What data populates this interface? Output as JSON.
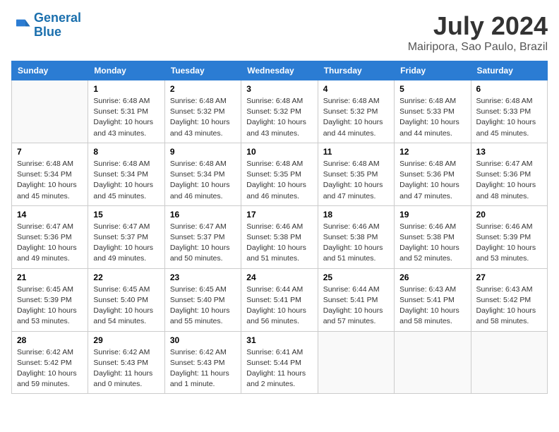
{
  "header": {
    "logo_line1": "General",
    "logo_line2": "Blue",
    "title": "July 2024",
    "subtitle": "Mairipora, Sao Paulo, Brazil"
  },
  "calendar": {
    "days_of_week": [
      "Sunday",
      "Monday",
      "Tuesday",
      "Wednesday",
      "Thursday",
      "Friday",
      "Saturday"
    ],
    "weeks": [
      [
        {
          "day": "",
          "info": ""
        },
        {
          "day": "1",
          "info": "Sunrise: 6:48 AM\nSunset: 5:31 PM\nDaylight: 10 hours\nand 43 minutes."
        },
        {
          "day": "2",
          "info": "Sunrise: 6:48 AM\nSunset: 5:32 PM\nDaylight: 10 hours\nand 43 minutes."
        },
        {
          "day": "3",
          "info": "Sunrise: 6:48 AM\nSunset: 5:32 PM\nDaylight: 10 hours\nand 43 minutes."
        },
        {
          "day": "4",
          "info": "Sunrise: 6:48 AM\nSunset: 5:32 PM\nDaylight: 10 hours\nand 44 minutes."
        },
        {
          "day": "5",
          "info": "Sunrise: 6:48 AM\nSunset: 5:33 PM\nDaylight: 10 hours\nand 44 minutes."
        },
        {
          "day": "6",
          "info": "Sunrise: 6:48 AM\nSunset: 5:33 PM\nDaylight: 10 hours\nand 45 minutes."
        }
      ],
      [
        {
          "day": "7",
          "info": "Sunrise: 6:48 AM\nSunset: 5:34 PM\nDaylight: 10 hours\nand 45 minutes."
        },
        {
          "day": "8",
          "info": "Sunrise: 6:48 AM\nSunset: 5:34 PM\nDaylight: 10 hours\nand 45 minutes."
        },
        {
          "day": "9",
          "info": "Sunrise: 6:48 AM\nSunset: 5:34 PM\nDaylight: 10 hours\nand 46 minutes."
        },
        {
          "day": "10",
          "info": "Sunrise: 6:48 AM\nSunset: 5:35 PM\nDaylight: 10 hours\nand 46 minutes."
        },
        {
          "day": "11",
          "info": "Sunrise: 6:48 AM\nSunset: 5:35 PM\nDaylight: 10 hours\nand 47 minutes."
        },
        {
          "day": "12",
          "info": "Sunrise: 6:48 AM\nSunset: 5:36 PM\nDaylight: 10 hours\nand 47 minutes."
        },
        {
          "day": "13",
          "info": "Sunrise: 6:47 AM\nSunset: 5:36 PM\nDaylight: 10 hours\nand 48 minutes."
        }
      ],
      [
        {
          "day": "14",
          "info": "Sunrise: 6:47 AM\nSunset: 5:36 PM\nDaylight: 10 hours\nand 49 minutes."
        },
        {
          "day": "15",
          "info": "Sunrise: 6:47 AM\nSunset: 5:37 PM\nDaylight: 10 hours\nand 49 minutes."
        },
        {
          "day": "16",
          "info": "Sunrise: 6:47 AM\nSunset: 5:37 PM\nDaylight: 10 hours\nand 50 minutes."
        },
        {
          "day": "17",
          "info": "Sunrise: 6:46 AM\nSunset: 5:38 PM\nDaylight: 10 hours\nand 51 minutes."
        },
        {
          "day": "18",
          "info": "Sunrise: 6:46 AM\nSunset: 5:38 PM\nDaylight: 10 hours\nand 51 minutes."
        },
        {
          "day": "19",
          "info": "Sunrise: 6:46 AM\nSunset: 5:38 PM\nDaylight: 10 hours\nand 52 minutes."
        },
        {
          "day": "20",
          "info": "Sunrise: 6:46 AM\nSunset: 5:39 PM\nDaylight: 10 hours\nand 53 minutes."
        }
      ],
      [
        {
          "day": "21",
          "info": "Sunrise: 6:45 AM\nSunset: 5:39 PM\nDaylight: 10 hours\nand 53 minutes."
        },
        {
          "day": "22",
          "info": "Sunrise: 6:45 AM\nSunset: 5:40 PM\nDaylight: 10 hours\nand 54 minutes."
        },
        {
          "day": "23",
          "info": "Sunrise: 6:45 AM\nSunset: 5:40 PM\nDaylight: 10 hours\nand 55 minutes."
        },
        {
          "day": "24",
          "info": "Sunrise: 6:44 AM\nSunset: 5:41 PM\nDaylight: 10 hours\nand 56 minutes."
        },
        {
          "day": "25",
          "info": "Sunrise: 6:44 AM\nSunset: 5:41 PM\nDaylight: 10 hours\nand 57 minutes."
        },
        {
          "day": "26",
          "info": "Sunrise: 6:43 AM\nSunset: 5:41 PM\nDaylight: 10 hours\nand 58 minutes."
        },
        {
          "day": "27",
          "info": "Sunrise: 6:43 AM\nSunset: 5:42 PM\nDaylight: 10 hours\nand 58 minutes."
        }
      ],
      [
        {
          "day": "28",
          "info": "Sunrise: 6:42 AM\nSunset: 5:42 PM\nDaylight: 10 hours\nand 59 minutes."
        },
        {
          "day": "29",
          "info": "Sunrise: 6:42 AM\nSunset: 5:43 PM\nDaylight: 11 hours\nand 0 minutes."
        },
        {
          "day": "30",
          "info": "Sunrise: 6:42 AM\nSunset: 5:43 PM\nDaylight: 11 hours\nand 1 minute."
        },
        {
          "day": "31",
          "info": "Sunrise: 6:41 AM\nSunset: 5:44 PM\nDaylight: 11 hours\nand 2 minutes."
        },
        {
          "day": "",
          "info": ""
        },
        {
          "day": "",
          "info": ""
        },
        {
          "day": "",
          "info": ""
        }
      ]
    ]
  }
}
